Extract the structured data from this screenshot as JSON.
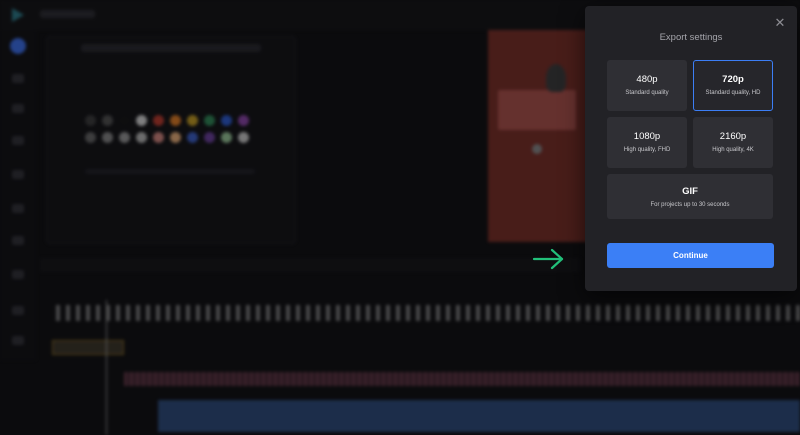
{
  "modal": {
    "title": "Export settings",
    "close_icon": "close-icon",
    "options": [
      {
        "id": "480p",
        "title": "480p",
        "subtitle": "Standard quality",
        "selected": false
      },
      {
        "id": "720p",
        "title": "720p",
        "subtitle": "Standard quality, HD",
        "selected": true
      },
      {
        "id": "1080p",
        "title": "1080p",
        "subtitle": "High quality, FHD",
        "selected": false
      },
      {
        "id": "2160p",
        "title": "2160p",
        "subtitle": "High quality, 4K",
        "selected": false
      },
      {
        "id": "gif",
        "title": "GIF",
        "subtitle": "For projects up to 30 seconds",
        "selected": false
      }
    ],
    "continue_label": "Continue"
  },
  "colors": {
    "accent": "#3b7ff6",
    "modal_bg": "#222226",
    "option_bg": "#2f2f34",
    "arrow": "#22c07a",
    "page_bg": "#0b0b0d"
  },
  "annotation": {
    "icon": "arrow-right-icon"
  }
}
